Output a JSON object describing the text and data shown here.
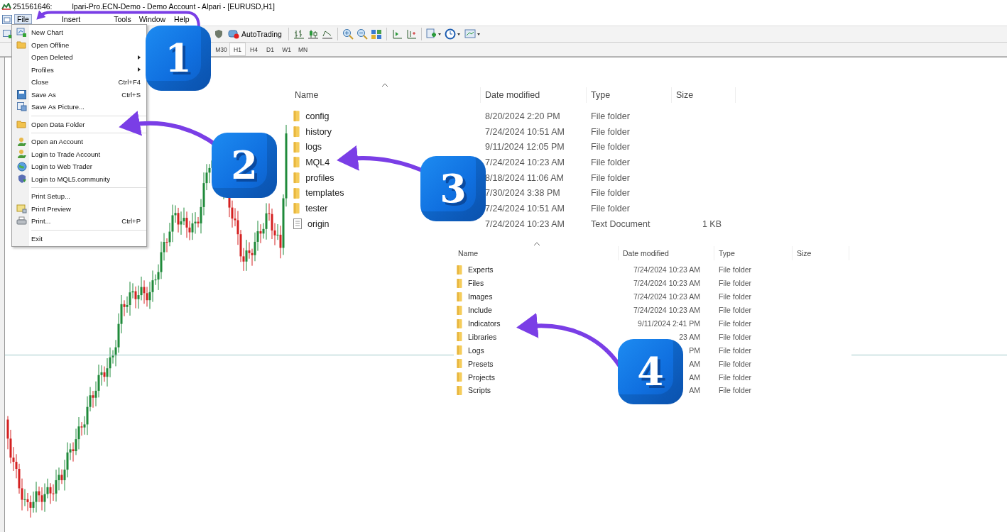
{
  "window": {
    "title_start": "251561646:",
    "title_end": "lpari-Pro.ECN-Demo - Demo Account - Alpari - [EURUSD,H1]"
  },
  "menu_bar": [
    {
      "label": "File",
      "selected": true
    },
    {
      "label": "Insert",
      "selected": false
    },
    {
      "label": "Tools",
      "selected": false
    },
    {
      "label": "Window",
      "selected": false
    },
    {
      "label": "Help",
      "selected": false
    }
  ],
  "file_menu": [
    {
      "kind": "item",
      "label": "New Chart"
    },
    {
      "kind": "item",
      "label": "Open Offline"
    },
    {
      "kind": "item",
      "label": "Open Deleted",
      "submenu": true
    },
    {
      "kind": "item",
      "label": "Profiles",
      "submenu": true
    },
    {
      "kind": "item",
      "label": "Close",
      "shortcut": "Ctrl+F4"
    },
    {
      "kind": "item",
      "label": "Save As",
      "shortcut": "Ctrl+S"
    },
    {
      "kind": "item",
      "label": "Save As Picture..."
    },
    {
      "kind": "separator"
    },
    {
      "kind": "item",
      "label": "Open Data Folder"
    },
    {
      "kind": "separator"
    },
    {
      "kind": "item",
      "label": "Open an Account"
    },
    {
      "kind": "item",
      "label": "Login to Trade Account"
    },
    {
      "kind": "item",
      "label": "Login to Web Trader"
    },
    {
      "kind": "item",
      "label": "Login to MQL5.community"
    },
    {
      "kind": "separator"
    },
    {
      "kind": "item",
      "label": "Print Setup..."
    },
    {
      "kind": "item",
      "label": "Print Preview"
    },
    {
      "kind": "item",
      "label": "Print...",
      "shortcut": "Ctrl+P"
    },
    {
      "kind": "separator"
    },
    {
      "kind": "item",
      "label": "Exit"
    }
  ],
  "toolbar": {
    "autotrading": "AutoTrading"
  },
  "timeframes": [
    {
      "label": "M30",
      "selected": false
    },
    {
      "label": "H1",
      "selected": true
    },
    {
      "label": "H4",
      "selected": false
    },
    {
      "label": "D1",
      "selected": false
    },
    {
      "label": "W1",
      "selected": false
    },
    {
      "label": "MN",
      "selected": false
    }
  ],
  "data_folder": {
    "columns": [
      "Name",
      "Date modified",
      "Type",
      "Size"
    ],
    "rows": [
      {
        "kind": "folder",
        "name": "config",
        "date": "8/20/2024 2:20 PM",
        "type": "File folder"
      },
      {
        "kind": "folder",
        "name": "history",
        "date": "7/24/2024 10:51 AM",
        "type": "File folder"
      },
      {
        "kind": "folder",
        "name": "logs",
        "date": "9/11/2024 12:05 PM",
        "type": "File folder"
      },
      {
        "kind": "folder",
        "name": "MQL4",
        "date": "7/24/2024 10:23 AM",
        "type": "File folder"
      },
      {
        "kind": "folder",
        "name": "profiles",
        "date": "8/18/2024 11:06 AM",
        "type": "File folder"
      },
      {
        "kind": "folder",
        "name": "templates",
        "date": "7/30/2024 3:38 PM",
        "type": "File folder"
      },
      {
        "kind": "folder",
        "name": "tester",
        "date": "7/24/2024 10:51 AM",
        "type": "File folder"
      },
      {
        "kind": "file",
        "name": "origin",
        "date": "7/24/2024 10:23 AM",
        "type": "Text Document",
        "size": "1 KB"
      }
    ]
  },
  "mql4_folder": {
    "columns": [
      "Name",
      "Date modified",
      "Type",
      "Size"
    ],
    "rows": [
      {
        "kind": "folder",
        "name": "Experts",
        "date": "7/24/2024 10:23 AM",
        "type": "File folder"
      },
      {
        "kind": "folder",
        "name": "Files",
        "date": "7/24/2024 10:23 AM",
        "type": "File folder"
      },
      {
        "kind": "folder",
        "name": "Images",
        "date": "7/24/2024 10:23 AM",
        "type": "File folder"
      },
      {
        "kind": "folder",
        "name": "Include",
        "date": "7/24/2024 10:23 AM",
        "type": "File folder"
      },
      {
        "kind": "folder",
        "name": "Indicators",
        "date": "9/11/2024 2:41 PM",
        "type": "File folder"
      },
      {
        "kind": "folder",
        "name": "Libraries",
        "date": "23 AM",
        "type": "File folder"
      },
      {
        "kind": "folder",
        "name": "Logs",
        "date": "PM",
        "type": "File folder"
      },
      {
        "kind": "folder",
        "name": "Presets",
        "date": "AM",
        "type": "File folder"
      },
      {
        "kind": "folder",
        "name": "Projects",
        "date": "AM",
        "type": "File folder"
      },
      {
        "kind": "folder",
        "name": "Scripts",
        "date": "AM",
        "type": "File folder"
      }
    ]
  },
  "callouts": [
    {
      "number": "1"
    },
    {
      "number": "2"
    },
    {
      "number": "3"
    },
    {
      "number": "4"
    }
  ]
}
